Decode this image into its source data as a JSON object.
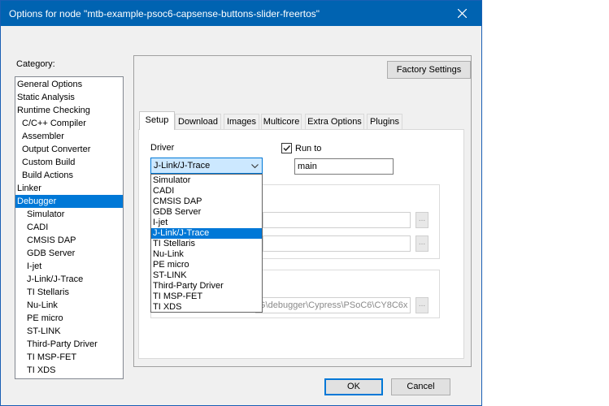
{
  "window": {
    "title": "Options for node \"mtb-example-psoc6-capsense-buttons-slider-freertos\""
  },
  "category": {
    "label": "Category:",
    "items": [
      {
        "label": "General Options",
        "indent": 0,
        "selected": false
      },
      {
        "label": "Static Analysis",
        "indent": 0,
        "selected": false
      },
      {
        "label": "Runtime Checking",
        "indent": 0,
        "selected": false
      },
      {
        "label": "C/C++ Compiler",
        "indent": 1,
        "selected": false
      },
      {
        "label": "Assembler",
        "indent": 1,
        "selected": false
      },
      {
        "label": "Output Converter",
        "indent": 1,
        "selected": false
      },
      {
        "label": "Custom Build",
        "indent": 1,
        "selected": false
      },
      {
        "label": "Build Actions",
        "indent": 1,
        "selected": false
      },
      {
        "label": "Linker",
        "indent": 0,
        "selected": false
      },
      {
        "label": "Debugger",
        "indent": 0,
        "selected": true
      },
      {
        "label": "Simulator",
        "indent": 2,
        "selected": false
      },
      {
        "label": "CADI",
        "indent": 2,
        "selected": false
      },
      {
        "label": "CMSIS DAP",
        "indent": 2,
        "selected": false
      },
      {
        "label": "GDB Server",
        "indent": 2,
        "selected": false
      },
      {
        "label": "I-jet",
        "indent": 2,
        "selected": false
      },
      {
        "label": "J-Link/J-Trace",
        "indent": 2,
        "selected": false
      },
      {
        "label": "TI Stellaris",
        "indent": 2,
        "selected": false
      },
      {
        "label": "Nu-Link",
        "indent": 2,
        "selected": false
      },
      {
        "label": "PE micro",
        "indent": 2,
        "selected": false
      },
      {
        "label": "ST-LINK",
        "indent": 2,
        "selected": false
      },
      {
        "label": "Third-Party Driver",
        "indent": 2,
        "selected": false
      },
      {
        "label": "TI MSP-FET",
        "indent": 2,
        "selected": false
      },
      {
        "label": "TI XDS",
        "indent": 2,
        "selected": false
      }
    ]
  },
  "factory_settings_label": "Factory Settings",
  "tabs": [
    {
      "label": "Setup",
      "active": true
    },
    {
      "label": "Download",
      "active": false
    },
    {
      "label": "Images",
      "active": false
    },
    {
      "label": "Multicore",
      "active": false
    },
    {
      "label": "Extra Options",
      "active": false
    },
    {
      "label": "Plugins",
      "active": false
    }
  ],
  "setup": {
    "driver_label": "Driver",
    "driver_value": "J-Link/J-Trace",
    "run_to_label": "Run to",
    "run_to_checked": true,
    "run_to_value": "main",
    "path_text": "G\\debugger\\Cypress\\PSoC6\\CY8C6x"
  },
  "driver_options": [
    {
      "label": "Simulator",
      "selected": false
    },
    {
      "label": "CADI",
      "selected": false
    },
    {
      "label": "CMSIS DAP",
      "selected": false
    },
    {
      "label": "GDB Server",
      "selected": false
    },
    {
      "label": "I-jet",
      "selected": false
    },
    {
      "label": "J-Link/J-Trace",
      "selected": true
    },
    {
      "label": "TI Stellaris",
      "selected": false
    },
    {
      "label": "Nu-Link",
      "selected": false
    },
    {
      "label": "PE micro",
      "selected": false
    },
    {
      "label": "ST-LINK",
      "selected": false
    },
    {
      "label": "Third-Party Driver",
      "selected": false
    },
    {
      "label": "TI MSP-FET",
      "selected": false
    },
    {
      "label": "TI XDS",
      "selected": false
    }
  ],
  "footer": {
    "ok_label": "OK",
    "cancel_label": "Cancel"
  },
  "colors": {
    "titlebar": "#0063b1",
    "selection": "#0078d7"
  }
}
